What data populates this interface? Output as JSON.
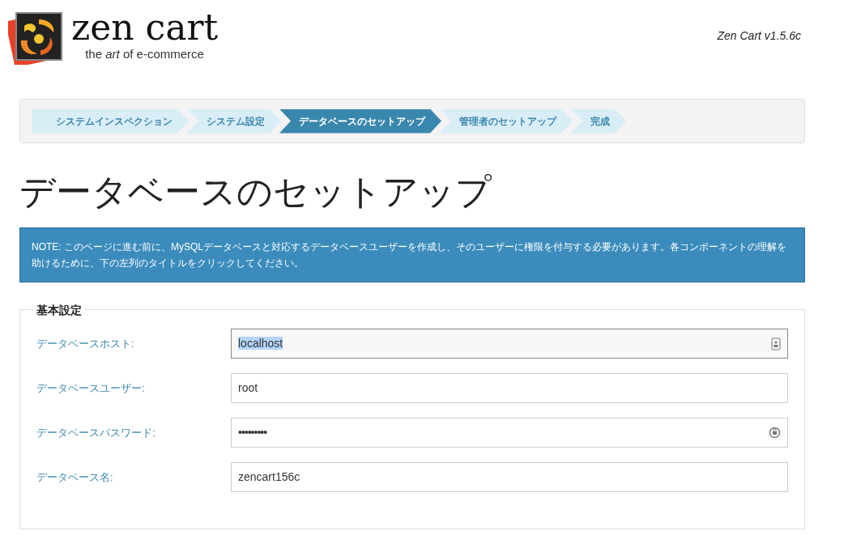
{
  "logo": {
    "name": "zen cart",
    "tagline": "the *art* of e-commerce"
  },
  "version": "Zen Cart v1.5.6c",
  "steps": [
    {
      "label": "システムインスペクション",
      "selected": false
    },
    {
      "label": "システム設定",
      "selected": false
    },
    {
      "label": "データベースのセットアップ",
      "selected": true
    },
    {
      "label": "管理者のセットアップ",
      "selected": false
    },
    {
      "label": "完成",
      "selected": false
    }
  ],
  "heading": "データベースのセットアップ",
  "note": "NOTE: このページに進む前に、MySQLデータベースと対応するデータベースユーザーを作成し、そのユーザーに権限を付与する必要があります。各コンポーネントの理解を助けるために、下の左列のタイトルをクリックしてください。",
  "section": {
    "legend": "基本設定",
    "fields": [
      {
        "label": "データベースホスト:",
        "value": "localhost",
        "kind": "text",
        "focused": true
      },
      {
        "label": "データベースユーザー:",
        "value": "root",
        "kind": "text",
        "focused": false
      },
      {
        "label": "データベースパスワード:",
        "value": "•••••••••",
        "kind": "password",
        "focused": false
      },
      {
        "label": "データベース名:",
        "value": "zencart156c",
        "kind": "text",
        "focused": false
      }
    ]
  }
}
